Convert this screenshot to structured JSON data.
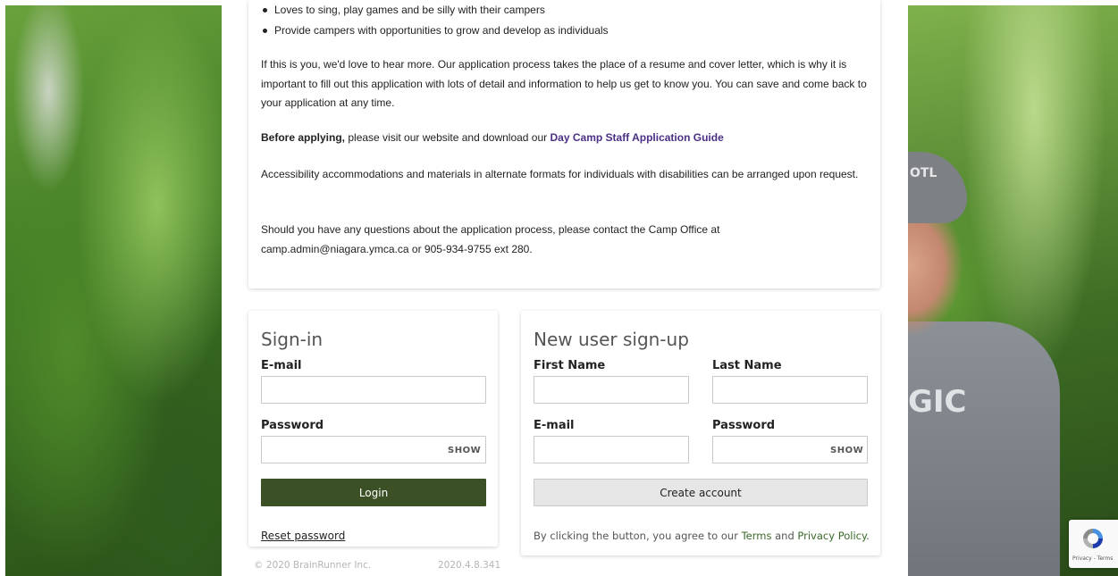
{
  "intro": {
    "bullets": [
      "Loves to sing, play games and be silly with their campers",
      "Provide campers with opportunities to grow and develop as individuals"
    ],
    "para1": "If this is you, we'd love to hear more. Our application process takes the place of a resume and cover letter, which is why it is important to fill out this application with lots of detail and information to help us get to know you. You can save and come back to your application at any time.",
    "before_bold": "Before applying,",
    "before_text": " please visit our website and download our ",
    "guide_link": "Day Camp Staff Application Guide",
    "para3": "Accessibility accommodations and materials in alternate formats for individuals with disabilities can be arranged upon request.",
    "para4": "Should you have any questions about the application process, please contact the Camp Office at camp.admin@niagara.ymca.ca or 905-934-9755 ext 280."
  },
  "signin": {
    "title": "Sign-in",
    "email_label": "E-mail",
    "email_value": "",
    "password_label": "Password",
    "password_value": "",
    "show_label": "SHOW",
    "login_label": "Login",
    "reset_label": "Reset password"
  },
  "signup": {
    "title": "New user sign-up",
    "first_name_label": "First Name",
    "first_name_value": "",
    "last_name_label": "Last Name",
    "last_name_value": "",
    "email_label": "E-mail",
    "email_value": "",
    "password_label": "Password",
    "password_value": "",
    "show_label": "SHOW",
    "create_label": "Create account",
    "agree_prefix": "By clicking the button, you agree to our ",
    "terms_label": "Terms",
    "agree_and": " and ",
    "privacy_label": "Privacy Policy",
    "agree_suffix": "."
  },
  "footer": {
    "copyright": "© 2020 BrainRunner Inc.",
    "version": "2020.4.8.341"
  },
  "recaptcha": {
    "text": "Privacy - Terms"
  },
  "background": {
    "shirt_text": "GIC",
    "cap_text": "OTL"
  },
  "colors": {
    "login_button": "#3c5025",
    "link_purple": "#4b2f86",
    "link_green": "#3c6a2a"
  }
}
